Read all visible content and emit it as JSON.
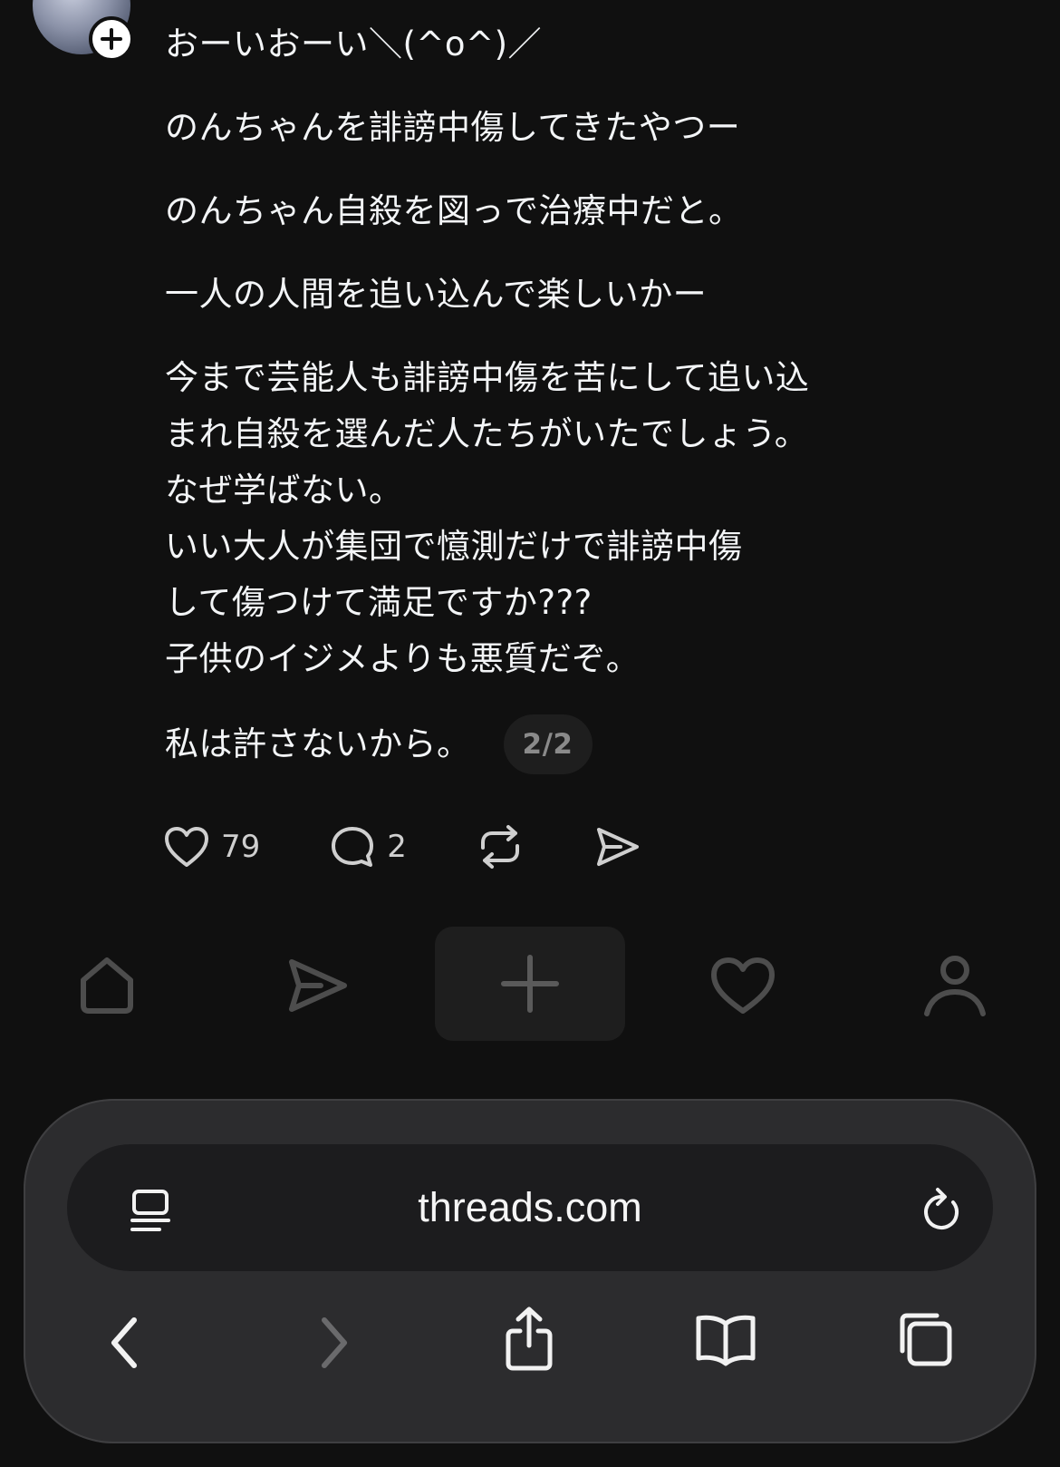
{
  "post": {
    "paragraphs": [
      "おーいおーい＼(^o^)／",
      "のんちゃんを誹謗中傷してきたやつー",
      "のんちゃん自殺を図っで治療中だと。",
      "一人の人間を追い込んで楽しいかー",
      "今まで芸能人も誹謗中傷を苦にして追い込\nまれ自殺を選んだ人たちがいたでしょう。\nなぜ学ばない。\nいい大人が集団で憶測だけで誹謗中傷\nして傷つけて満足ですか???\n子供のイジメよりも悪質だぞ。"
    ],
    "last_line": "私は許さないから。",
    "page_indicator": "2/2"
  },
  "actions": {
    "likes": "79",
    "replies": "2"
  },
  "icons": {
    "avatar_badge": "follow-plus-icon",
    "like": "heart-icon",
    "reply": "comment-bubble-icon",
    "repost": "repost-icon",
    "share": "send-icon",
    "tabs": [
      "home-icon",
      "send-icon",
      "plus-icon",
      "heart-icon",
      "profile-icon"
    ],
    "browser": [
      "reader-icon",
      "reload-icon",
      "back-icon",
      "forward-icon",
      "share-icon",
      "bookmarks-icon",
      "tabs-icon"
    ]
  },
  "browser": {
    "url": "threads.com"
  },
  "colors": {
    "background": "#101010",
    "text": "#f3f5f7",
    "muted": "#8a8a8a",
    "toolbar": "#2c2c2e"
  }
}
